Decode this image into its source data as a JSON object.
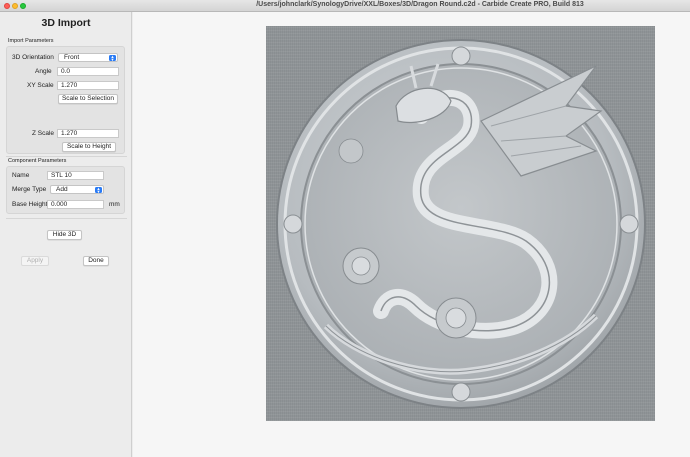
{
  "window": {
    "title": "/Users/johnclark/SynologyDrive/XXL/Boxes/3D/Dragon Round.c2d - Carbide Create PRO, Build 813"
  },
  "panel": {
    "title": "3D Import",
    "import_params": {
      "label": "Import Parameters",
      "orientation_label": "3D Orientation",
      "orientation_value": "Front",
      "angle_label": "Angle",
      "angle_value": "0.0",
      "xy_scale_label": "XY Scale",
      "xy_scale_value": "1.270",
      "scale_to_selection_label": "Scale to Selection",
      "z_scale_label": "Z Scale",
      "z_scale_value": "1.270",
      "scale_to_height_label": "Scale to Height"
    },
    "component_params": {
      "label": "Component Parameters",
      "name_label": "Name",
      "name_value": "STL 10",
      "merge_type_label": "Merge Type",
      "merge_type_value": "Add",
      "base_height_label": "Base Height",
      "base_height_value": "0.000",
      "base_height_unit": "mm"
    },
    "hide_3d_label": "Hide 3D",
    "apply_label": "Apply",
    "done_label": "Done"
  },
  "colors": {
    "accent": "#2a7bf5",
    "relief": "#8f9497",
    "relief_highlight": "#d8dcdf"
  },
  "icons": [
    "close-button-icon",
    "minimize-button-icon",
    "zoom-button-icon",
    "chevron-updown-icon"
  ]
}
